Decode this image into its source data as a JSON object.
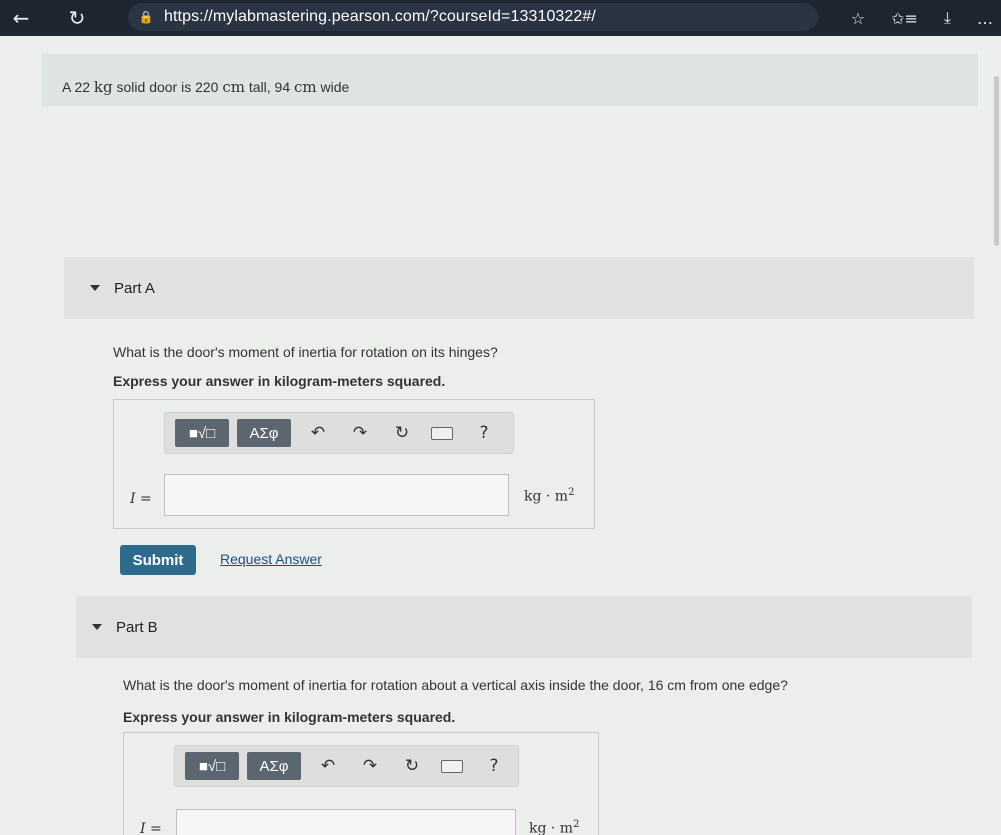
{
  "browser": {
    "url": "https://mylabmastering.pearson.com/?courseId=13310322#/",
    "back_icon": "←",
    "reload_icon": "↻",
    "lock_icon": "🔒",
    "star_icon": "☆",
    "favorites_icon": "✩≡",
    "download_icon": "⤓",
    "more_icon": "…"
  },
  "intro": {
    "pre": "A 22 ",
    "unit_kg": "kg",
    "mid1": " solid door is 220 ",
    "unit_cm1": "cm",
    "mid2": " tall, 94 ",
    "unit_cm2": "cm",
    "post": " wide"
  },
  "partA": {
    "label": "Part A",
    "question": "What is the door's moment of inertia for rotation on its hinges?",
    "instruction": "Express your answer in kilogram-meters squared.",
    "variable": "I =",
    "unit": "kg · m",
    "unit_exp": "2",
    "toolbar": {
      "templates": "■√□",
      "greek": "ΑΣφ",
      "undo": "↶",
      "redo": "↷",
      "reset": "↻",
      "help": "?"
    }
  },
  "actions": {
    "submit": "Submit",
    "request": "Request Answer"
  },
  "partB": {
    "label": "Part B",
    "question": "What is the door's moment of inertia for  rotation about a vertical axis inside the door, 16 cm from one edge?",
    "instruction": "Express your answer in kilogram-meters squared.",
    "variable": "I =",
    "unit": "kg · m",
    "unit_exp": "2",
    "toolbar": {
      "templates": "■√□",
      "greek": "ΑΣφ",
      "undo": "↶",
      "redo": "↷",
      "reset": "↻",
      "help": "?"
    }
  }
}
